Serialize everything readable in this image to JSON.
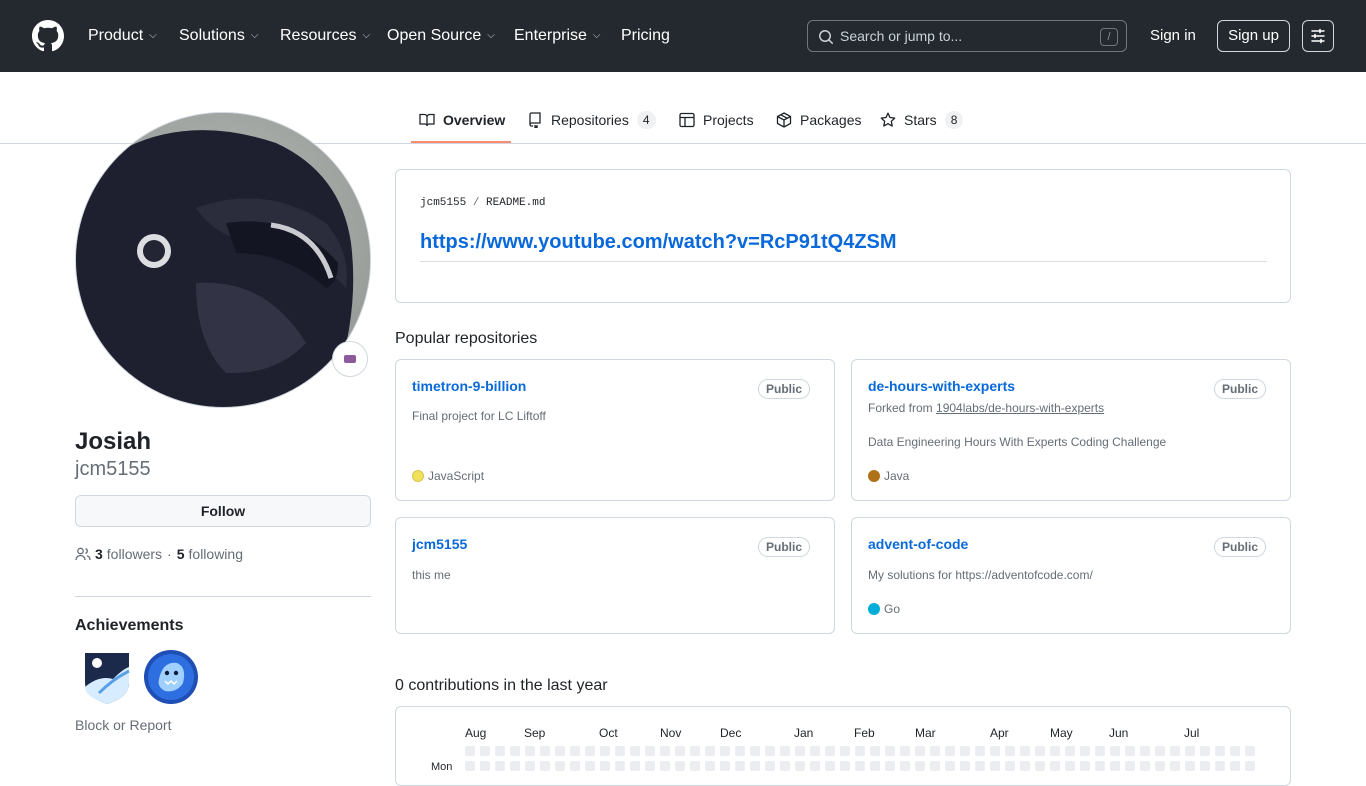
{
  "header": {
    "nav": [
      {
        "label": "Product",
        "chevron": true
      },
      {
        "label": "Solutions",
        "chevron": true
      },
      {
        "label": "Resources",
        "chevron": true
      },
      {
        "label": "Open Source",
        "chevron": true
      },
      {
        "label": "Enterprise",
        "chevron": true
      },
      {
        "label": "Pricing",
        "chevron": false
      }
    ],
    "search_placeholder": "Search or jump to...",
    "search_shortcut": "/",
    "signin": "Sign in",
    "signup": "Sign up"
  },
  "tabs": [
    {
      "label": "Overview",
      "icon": "book-icon",
      "count": null,
      "selected": true
    },
    {
      "label": "Repositories",
      "icon": "repo-icon",
      "count": "4"
    },
    {
      "label": "Projects",
      "icon": "table-icon",
      "count": null
    },
    {
      "label": "Packages",
      "icon": "package-icon",
      "count": null
    },
    {
      "label": "Stars",
      "icon": "star-icon",
      "count": "8"
    }
  ],
  "profile": {
    "name": "Josiah",
    "login": "jcm5155",
    "follow_label": "Follow",
    "followers_count": "3",
    "followers_label": "followers",
    "separator": "·",
    "following_count": "5",
    "following_label": "following",
    "achievements_title": "Achievements",
    "block_report": "Block or Report"
  },
  "readme": {
    "owner": "jcm5155",
    "separator": "/",
    "file": "README.md",
    "link": "https://www.youtube.com/watch?v=RcP91tQ4ZSM"
  },
  "popular_title": "Popular repositories",
  "repos": [
    {
      "name": "timetron-9-billion",
      "visibility": "Public",
      "description": "Final project for LC Liftoff",
      "language": "JavaScript",
      "language_color": "#f1e05a"
    },
    {
      "name": "de-hours-with-experts",
      "visibility": "Public",
      "forked_prefix": "Forked from",
      "forked_from": "1904labs/de-hours-with-experts",
      "description": "Data Engineering Hours With Experts Coding Challenge",
      "language": "Java",
      "language_color": "#b07219"
    },
    {
      "name": "jcm5155",
      "visibility": "Public",
      "description": "this me",
      "language": "",
      "language_color": ""
    },
    {
      "name": "advent-of-code",
      "visibility": "Public",
      "description": "My solutions for https://adventofcode.com/",
      "language": "Go",
      "language_color": "#00ADD8"
    }
  ],
  "contributions": {
    "title": "0 contributions in the last year",
    "months": [
      "Aug",
      "Sep",
      "Oct",
      "Nov",
      "Dec",
      "Jan",
      "Feb",
      "Mar",
      "Apr",
      "May",
      "Jun",
      "Jul"
    ],
    "day_label": "Mon"
  },
  "colors": {
    "header_bg": "#24292f",
    "link": "#0969da",
    "tab_underline": "#fd8c73",
    "empty_cell": "#ebedf0"
  }
}
